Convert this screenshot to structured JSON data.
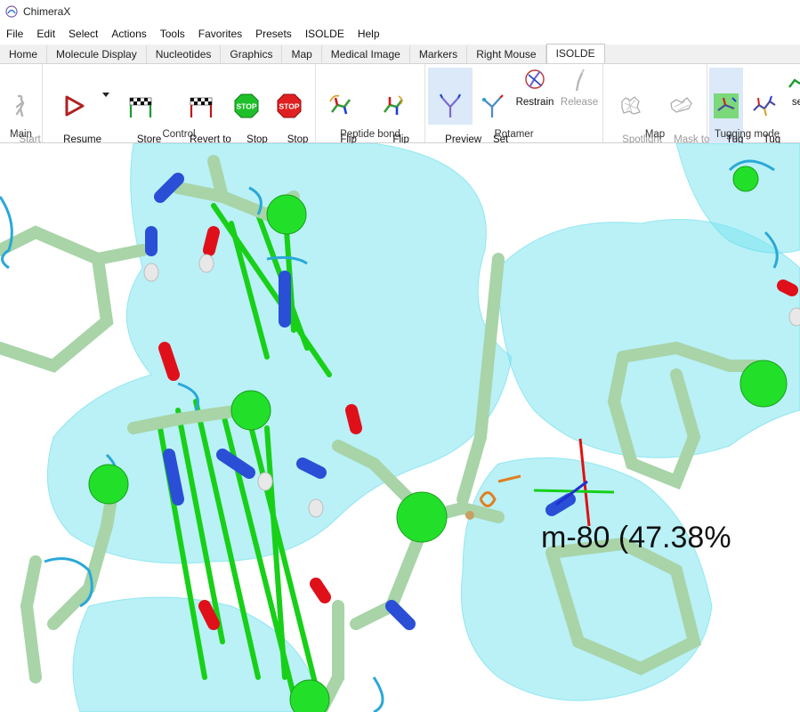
{
  "window": {
    "title": "ChimeraX"
  },
  "menu": [
    "File",
    "Edit",
    "Select",
    "Actions",
    "Tools",
    "Favorites",
    "Presets",
    "ISOLDE",
    "Help"
  ],
  "tabs": [
    {
      "label": "Home"
    },
    {
      "label": "Molecule Display"
    },
    {
      "label": "Nucleotides"
    },
    {
      "label": "Graphics"
    },
    {
      "label": "Map"
    },
    {
      "label": "Medical Image"
    },
    {
      "label": "Markers"
    },
    {
      "label": "Right Mouse"
    },
    {
      "label": "ISOLDE"
    }
  ],
  "ribbon": {
    "main": {
      "label": "Main",
      "start": "Start\nISOLDE"
    },
    "control": {
      "label": "Control",
      "resume": "Resume\nsimulation",
      "store": "Store\ncheckpoint",
      "revert": "Revert to\ncheckpoint",
      "stop_keep": "Stop\n(keep)",
      "stop_discard": "Stop\n(discard)",
      "stop_icon_text": "STOP"
    },
    "peptide": {
      "label": "Peptide bond",
      "flip": "Flip\npeptide",
      "cistrans": "Flip\ncis<->trans"
    },
    "rotamer": {
      "label": "Rotamer",
      "preview": "Preview\nnext",
      "set": "Set\ncoords",
      "restrain": "Restrain",
      "release": "Release"
    },
    "map": {
      "label": "Map",
      "spotlight": "Spotlight\nmode",
      "mask": "Mask to\nselection"
    },
    "tugging": {
      "label": "Tugging mode",
      "atom": "Tug\natom",
      "residue": "Tug\nresidue",
      "sel": "se"
    }
  },
  "viewport": {
    "rotamer_label": "m-80 (47.38%"
  },
  "colors": {
    "map_surface": "#7fe6f0",
    "carbon": "#a8d4a8",
    "alpha_carbon": "#22e02a",
    "nitrogen": "#2a4fd6",
    "oxygen": "#e0101a",
    "restraint": "#18d018",
    "ribbon": "#2aa8d8"
  }
}
